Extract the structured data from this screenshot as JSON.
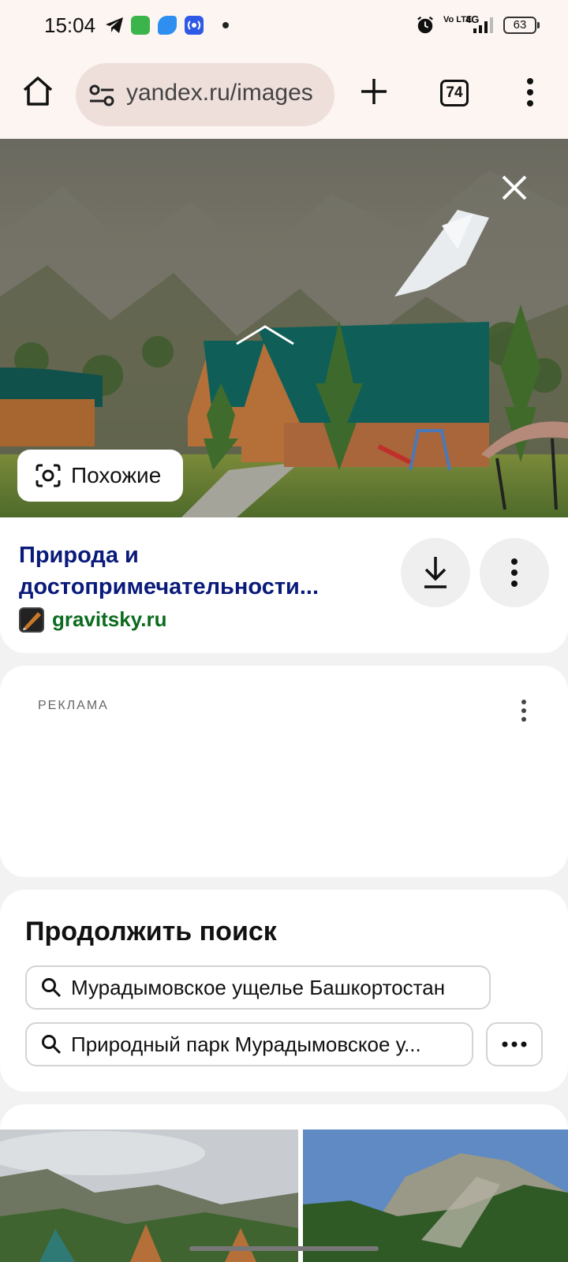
{
  "status_bar": {
    "time": "15:04",
    "network": "4G",
    "volte": "Vo LTE",
    "battery": "63",
    "icons": [
      "telegram-icon",
      "app-icon-green",
      "app-icon-blue",
      "app-icon-radio",
      "notification-dot",
      "alarm-icon",
      "volte-icon",
      "signal-icon",
      "battery-icon"
    ]
  },
  "toolbar": {
    "url": "yandex.ru/images",
    "tab_count": "74",
    "icons": [
      "home-icon",
      "site-settings-icon",
      "new-tab-icon",
      "tabs-icon",
      "menu-icon"
    ]
  },
  "viewer": {
    "similar_label": "Похожие",
    "icons": [
      "close-icon",
      "camera-search-icon"
    ]
  },
  "result": {
    "title": "Природа и достопримечательности...",
    "domain": "gravitsky.ru",
    "icons": [
      "favicon",
      "download-icon",
      "more-vertical-icon"
    ]
  },
  "ad": {
    "label": "РЕКЛАМА"
  },
  "continue_search": {
    "title": "Продолжить поиск",
    "queries": [
      "Мурадымовское ущелье Башкортостан",
      "Природный парк Мурадымовское у..."
    ],
    "icons": [
      "search-icon",
      "more-horizontal-icon"
    ]
  },
  "colors": {
    "browser_chrome": "#fcf5f2",
    "url_pill": "#eedfdb",
    "title_link": "#0a1a7a",
    "domain_link": "#0b6b1e",
    "roof_green": "#0f5f58",
    "wood": "#b5703a"
  }
}
